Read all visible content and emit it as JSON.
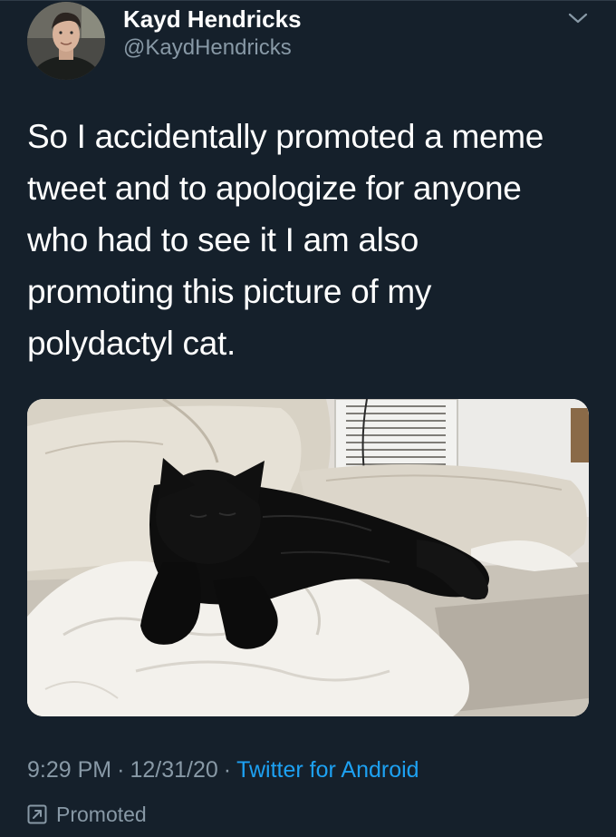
{
  "tweet": {
    "author": {
      "display_name": "Kayd Hendricks",
      "handle": "@KaydHendricks"
    },
    "text": "So I accidentally promoted a meme\ntweet and to apologize for anyone\nwho had to see it I am also\npromoting this picture of my\npolydactyl cat.",
    "timestamp": {
      "time": "9:29 PM",
      "separator": "·",
      "date": "12/31/20",
      "source": "Twitter for Android"
    },
    "promoted_label": "Promoted"
  },
  "colors": {
    "background": "#15202b",
    "link": "#1da1f2",
    "secondary_text": "#8899a6"
  },
  "icons": {
    "menu": "chevron-down-icon",
    "promoted": "promoted-arrow-icon"
  }
}
